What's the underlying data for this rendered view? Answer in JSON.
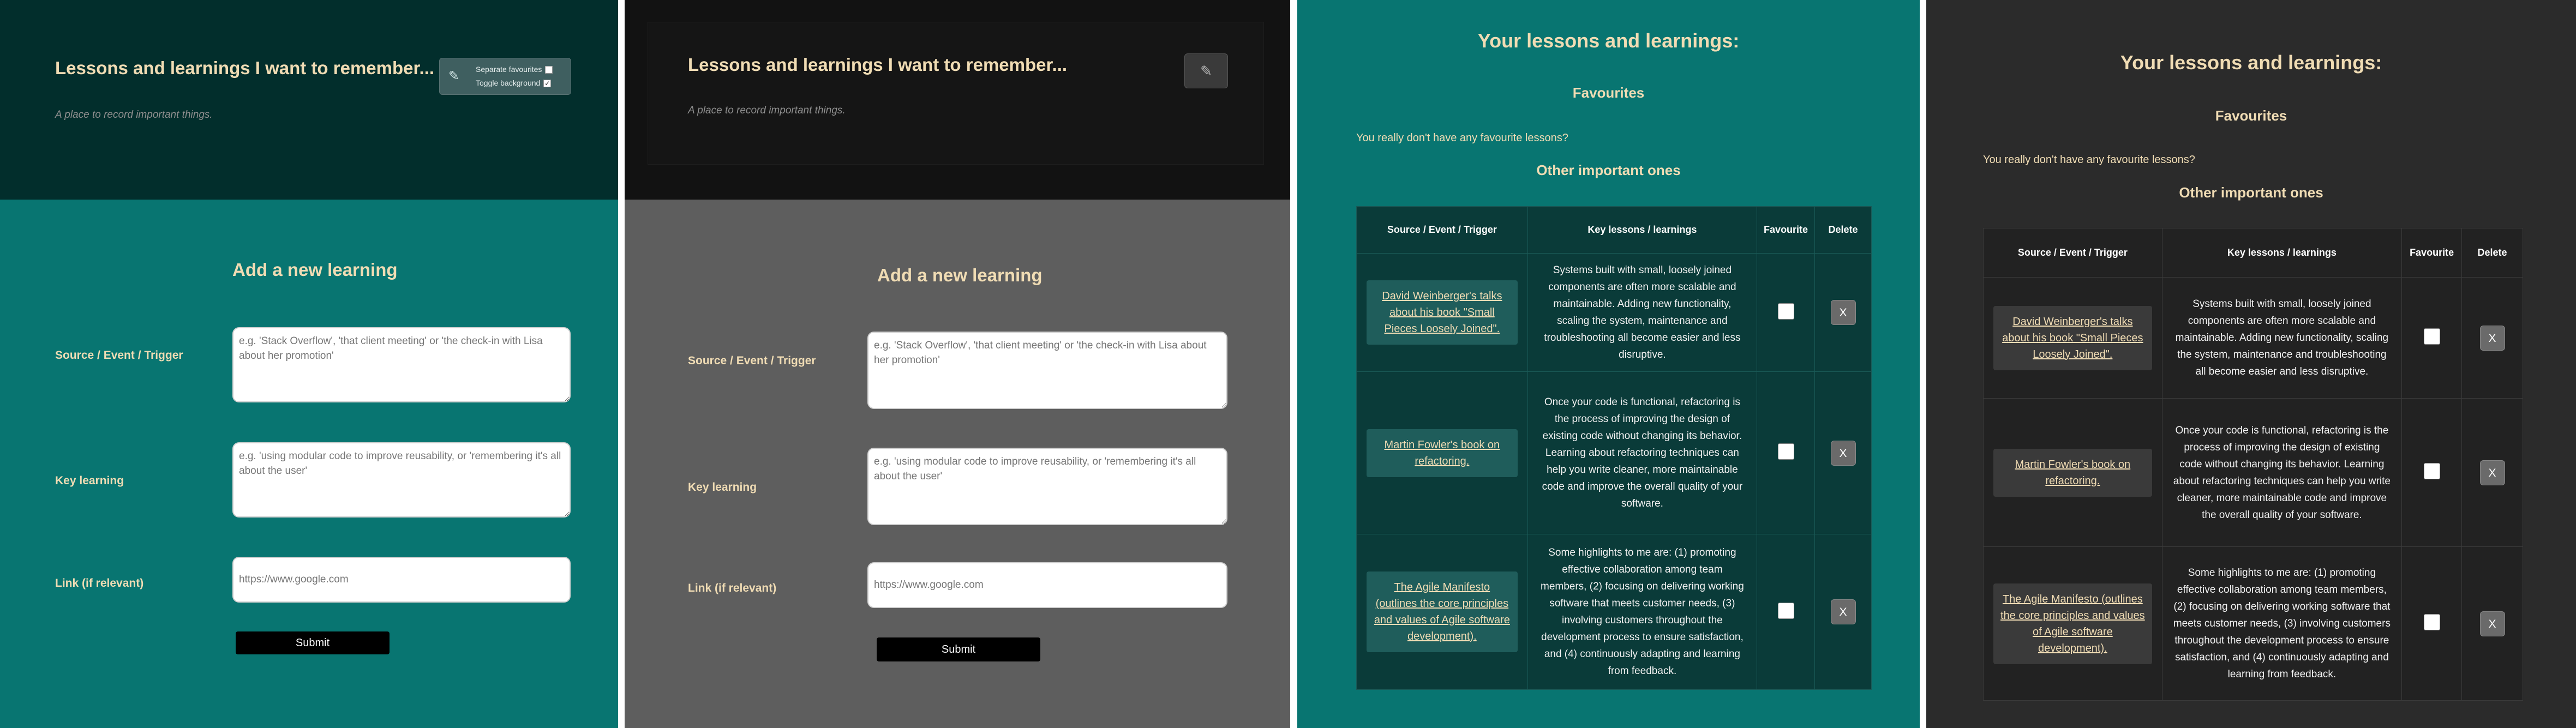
{
  "form_page": {
    "title": "Lessons and learnings I want to remember...",
    "subtitle": "A place to record important things.",
    "toggle_separate_favourites": "Separate favourites",
    "toggle_background": "Toggle background",
    "form_title": "Add a new learning",
    "fields": [
      {
        "label": "Source / Event / Trigger",
        "placeholder": "e.g. 'Stack Overflow', 'that client meeting' or 'the check-in with Lisa about her promotion'"
      },
      {
        "label": "Key learning",
        "placeholder": "e.g. 'using modular code to improve reusability, or 'remembering it's all about the user'"
      },
      {
        "label": "Link (if relevant)",
        "placeholder": "https://www.google.com"
      }
    ],
    "submit_label": "Submit"
  },
  "list_page": {
    "title": "Your lessons and learnings:",
    "favourites_heading": "Favourites",
    "no_favourites_text": "You really don't have any favourite lessons?",
    "other_heading": "Other important ones",
    "columns": [
      "Source / Event / Trigger",
      "Key lessons / learnings",
      "Favourite",
      "Delete"
    ],
    "rows": [
      {
        "source": "David Weinberger's talks about his book \"Small Pieces Loosely Joined\".",
        "lesson": "Systems built with small, loosely joined components are often more scalable and maintainable. Adding new functionality, scaling the system, maintenance and troubleshooting all become easier and less disruptive.",
        "delete_label": "X"
      },
      {
        "source": "Martin Fowler's book on refactoring.",
        "lesson": "Once your code is functional, refactoring is the process of improving the design of existing code without changing its behavior. Learning about refactoring techniques can help you write cleaner, more maintainable code and improve the overall quality of your software.",
        "delete_label": "X"
      },
      {
        "source": "The Agile Manifesto (outlines the core principles and values of Agile software development).",
        "lesson": "Some highlights to me are: (1) promoting effective collaboration among team members, (2) focusing on delivering working software that meets customer needs, (3) involving customers throughout the development process to ensure satisfaction, and (4) continuously adapting and learning from feedback.",
        "delete_label": "X"
      }
    ]
  },
  "colors": {
    "teal": "#087571",
    "dark_teal": "#022e2c",
    "cream": "#f0dcb4",
    "dark": "#121212",
    "grey": "#5e5e5e"
  }
}
